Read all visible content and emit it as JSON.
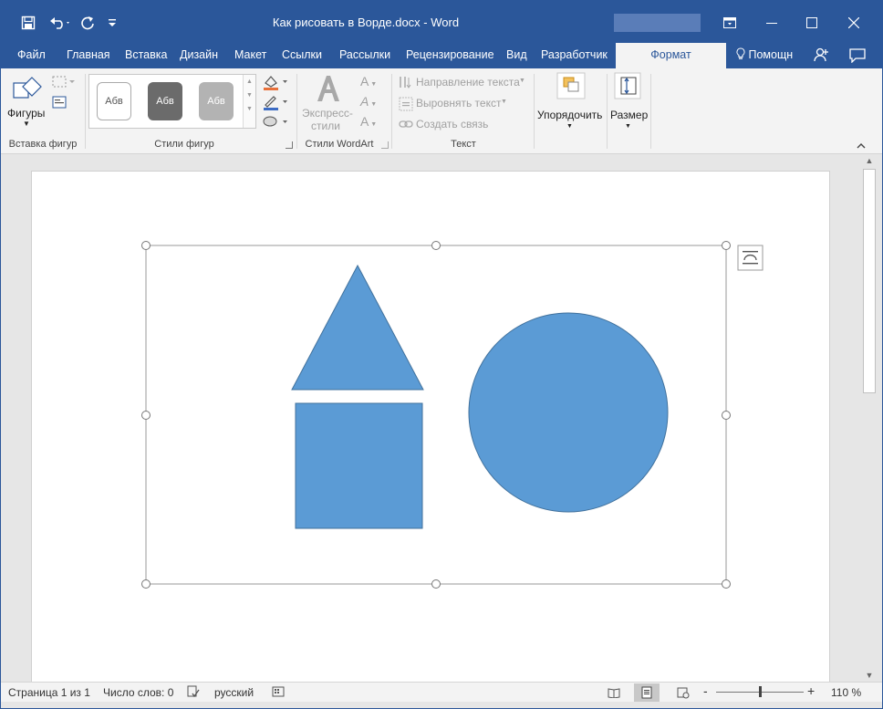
{
  "window": {
    "title": "Как рисовать в Ворде.docx - Word",
    "accent_color": "#2b579a",
    "controls": {
      "ribbon_options": "ribbon-display-icon",
      "minimize": "minimize-icon",
      "maximize": "maximize-icon",
      "close": "close-icon"
    }
  },
  "quick_access": {
    "save": "save-icon",
    "undo": "undo-icon",
    "redo": "redo-icon",
    "customize": "customize-icon"
  },
  "tabs": [
    {
      "label": "Файл"
    },
    {
      "label": "Главная"
    },
    {
      "label": "Вставка"
    },
    {
      "label": "Дизайн"
    },
    {
      "label": "Макет"
    },
    {
      "label": "Ссылки"
    },
    {
      "label": "Рассылки"
    },
    {
      "label": "Рецензирование"
    },
    {
      "label": "Вид"
    },
    {
      "label": "Разработчик"
    },
    {
      "label": "Формат",
      "active": true
    }
  ],
  "help": {
    "label": "Помощн"
  },
  "ribbon": {
    "insert_shapes": {
      "shapes_label": "Фигуры",
      "group_label": "Вставка фигур"
    },
    "shape_styles": {
      "thumbs": [
        "Абв",
        "Абв",
        "Абв"
      ],
      "group_label": "Стили фигур"
    },
    "wordart": {
      "express_label_1": "Экспресс-",
      "express_label_2": "стили",
      "group_label": "Стили WordArt",
      "letter": "A"
    },
    "text": {
      "direction": "Направление текста",
      "align": "Выровнять текст",
      "link": "Создать связь",
      "group_label": "Текст"
    },
    "arrange": {
      "label": "Упорядочить"
    },
    "size": {
      "label": "Размер"
    }
  },
  "canvas": {
    "fill_color": "#5b9bd5",
    "outline_color": "#41719c",
    "shapes": [
      "triangle",
      "rectangle",
      "circle"
    ]
  },
  "statusbar": {
    "page": "Страница 1 из 1",
    "words": "Число слов: 0",
    "language": "русский",
    "zoom": "110 %",
    "zoom_minus": "-",
    "zoom_plus": "+"
  }
}
